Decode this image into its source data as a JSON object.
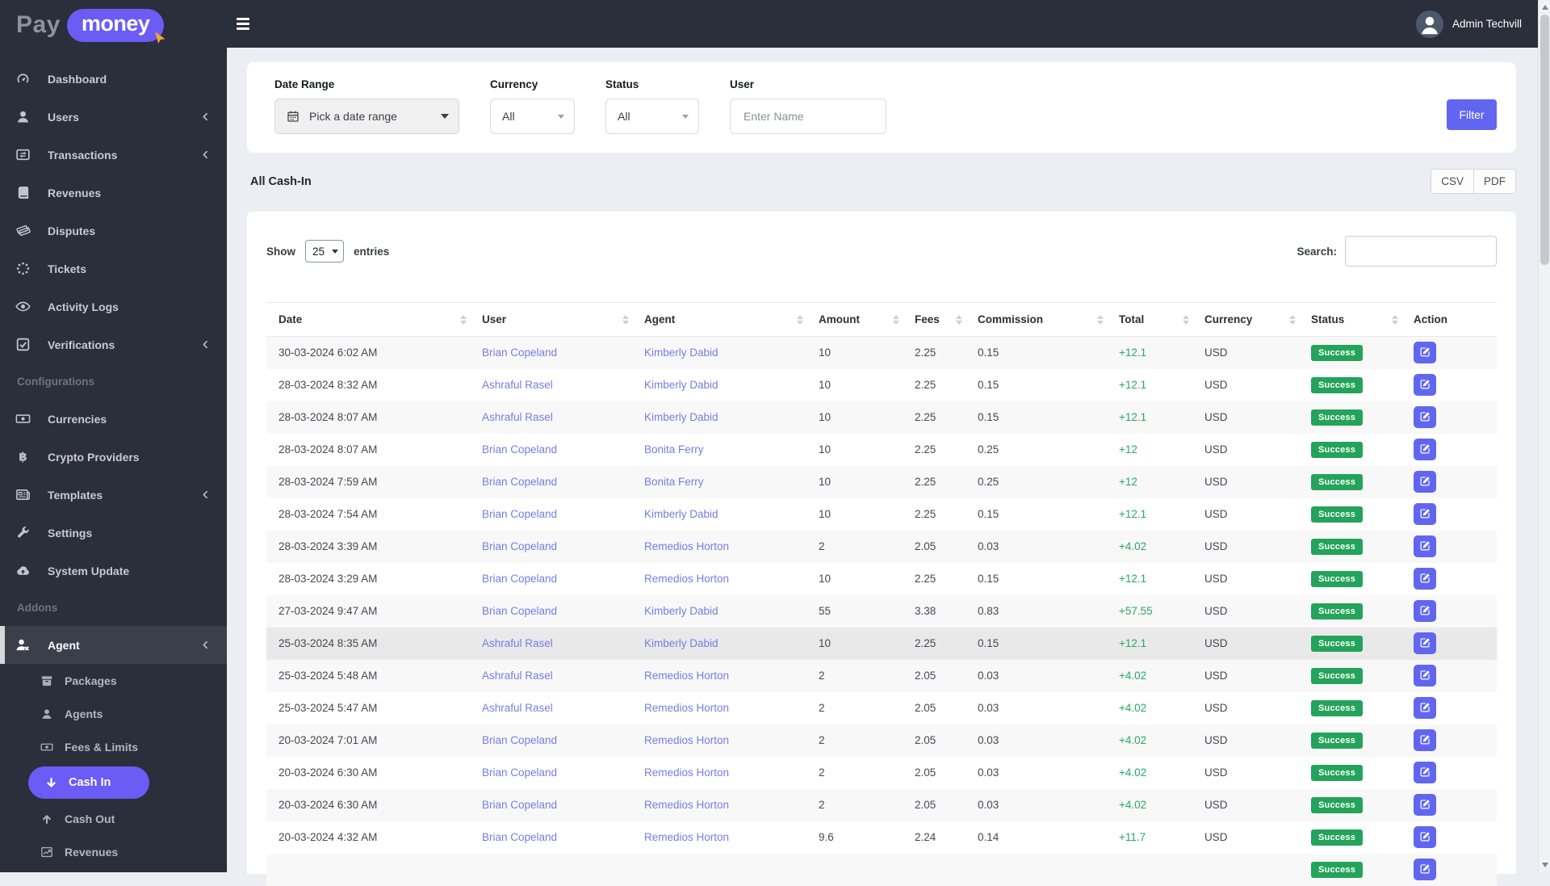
{
  "colors": {
    "sidebar_bg": "#2b2e3b",
    "brand_purple": "#6a5cf5",
    "primary": "#6166f0",
    "link": "#787ce2",
    "total_green": "#28a767",
    "badge_green": "#24a35a",
    "cursor_orange": "#f2a33c",
    "page_bg": "#edeef3"
  },
  "logo": {
    "part1": "Pay",
    "part2": "money"
  },
  "topbar": {
    "user_name": "Admin Techvill"
  },
  "sidebar": {
    "items": [
      {
        "type": "item",
        "icon": "gauge-icon",
        "label": "Dashboard"
      },
      {
        "type": "item",
        "icon": "user-icon",
        "label": "Users",
        "chevron": true
      },
      {
        "type": "item",
        "icon": "transactions-icon",
        "label": "Transactions",
        "chevron": true
      },
      {
        "type": "item",
        "icon": "book-icon",
        "label": "Revenues"
      },
      {
        "type": "item",
        "icon": "ticket-icon",
        "label": "Disputes"
      },
      {
        "type": "item",
        "icon": "spinner-icon",
        "label": "Tickets"
      },
      {
        "type": "item",
        "icon": "eye-icon",
        "label": "Activity Logs"
      },
      {
        "type": "item",
        "icon": "check-square-icon",
        "label": "Verifications",
        "chevron": true
      },
      {
        "type": "section",
        "label": "Configurations"
      },
      {
        "type": "item",
        "icon": "money-icon",
        "label": "Currencies"
      },
      {
        "type": "item",
        "icon": "bitcoin-icon",
        "label": "Crypto Providers"
      },
      {
        "type": "item",
        "icon": "newspaper-icon",
        "label": "Templates",
        "chevron": true
      },
      {
        "type": "item",
        "icon": "wrench-icon",
        "label": "Settings"
      },
      {
        "type": "item",
        "icon": "cloud-upload-icon",
        "label": "System Update"
      },
      {
        "type": "section",
        "label": "Addons"
      },
      {
        "type": "item",
        "icon": "user-x-icon",
        "label": "Agent",
        "chevron": true,
        "active": true
      },
      {
        "type": "subitem",
        "icon": "box-icon",
        "label": "Packages"
      },
      {
        "type": "subitem",
        "icon": "user-icon",
        "label": "Agents"
      },
      {
        "type": "subitem",
        "icon": "money-icon",
        "label": "Fees & Limits"
      },
      {
        "type": "pill",
        "icon": "arrow-down-icon",
        "label": "Cash In"
      },
      {
        "type": "subitem",
        "icon": "arrow-up-icon",
        "label": "Cash Out"
      },
      {
        "type": "subitem",
        "icon": "chart-icon",
        "label": "Revenues"
      }
    ]
  },
  "filters": {
    "date_range": {
      "label": "Date Range",
      "value": "Pick a date range"
    },
    "currency": {
      "label": "Currency",
      "value": "All"
    },
    "status": {
      "label": "Status",
      "value": "All"
    },
    "user": {
      "label": "User",
      "placeholder": "Enter Name"
    },
    "filter_button": "Filter"
  },
  "listing": {
    "title": "All Cash-In",
    "export_buttons": [
      "CSV",
      "PDF"
    ],
    "show_label": "Show",
    "page_length": "25",
    "entries_label": "entries",
    "search_label": "Search:"
  },
  "table": {
    "columns": [
      "Date",
      "User",
      "Agent",
      "Amount",
      "Fees",
      "Commission",
      "Total",
      "Currency",
      "Status",
      "Action"
    ],
    "rows": [
      {
        "date": "30-03-2024 6:02 AM",
        "user": "Brian Copeland",
        "agent": "Kimberly Dabid",
        "amount": "10",
        "fees": "2.25",
        "commission": "0.15",
        "total": "+12.1",
        "currency": "USD",
        "status": "Success"
      },
      {
        "date": "28-03-2024 8:32 AM",
        "user": "Ashraful Rasel",
        "agent": "Kimberly Dabid",
        "amount": "10",
        "fees": "2.25",
        "commission": "0.15",
        "total": "+12.1",
        "currency": "USD",
        "status": "Success"
      },
      {
        "date": "28-03-2024 8:07 AM",
        "user": "Ashraful Rasel",
        "agent": "Kimberly Dabid",
        "amount": "10",
        "fees": "2.25",
        "commission": "0.15",
        "total": "+12.1",
        "currency": "USD",
        "status": "Success"
      },
      {
        "date": "28-03-2024 8:07 AM",
        "user": "Brian Copeland",
        "agent": "Bonita Ferry",
        "amount": "10",
        "fees": "2.25",
        "commission": "0.25",
        "total": "+12",
        "currency": "USD",
        "status": "Success"
      },
      {
        "date": "28-03-2024 7:59 AM",
        "user": "Brian Copeland",
        "agent": "Bonita Ferry",
        "amount": "10",
        "fees": "2.25",
        "commission": "0.25",
        "total": "+12",
        "currency": "USD",
        "status": "Success"
      },
      {
        "date": "28-03-2024 7:54 AM",
        "user": "Brian Copeland",
        "agent": "Kimberly Dabid",
        "amount": "10",
        "fees": "2.25",
        "commission": "0.15",
        "total": "+12.1",
        "currency": "USD",
        "status": "Success"
      },
      {
        "date": "28-03-2024 3:39 AM",
        "user": "Brian Copeland",
        "agent": "Remedios Horton",
        "amount": "2",
        "fees": "2.05",
        "commission": "0.03",
        "total": "+4.02",
        "currency": "USD",
        "status": "Success"
      },
      {
        "date": "28-03-2024 3:29 AM",
        "user": "Brian Copeland",
        "agent": "Remedios Horton",
        "amount": "10",
        "fees": "2.25",
        "commission": "0.15",
        "total": "+12.1",
        "currency": "USD",
        "status": "Success"
      },
      {
        "date": "27-03-2024 9:47 AM",
        "user": "Brian Copeland",
        "agent": "Kimberly Dabid",
        "amount": "55",
        "fees": "3.38",
        "commission": "0.83",
        "total": "+57.55",
        "currency": "USD",
        "status": "Success"
      },
      {
        "date": "25-03-2024 8:35 AM",
        "user": "Ashraful Rasel",
        "agent": "Kimberly Dabid",
        "amount": "10",
        "fees": "2.25",
        "commission": "0.15",
        "total": "+12.1",
        "currency": "USD",
        "status": "Success",
        "highlighted": true
      },
      {
        "date": "25-03-2024 5:48 AM",
        "user": "Ashraful Rasel",
        "agent": "Remedios Horton",
        "amount": "2",
        "fees": "2.05",
        "commission": "0.03",
        "total": "+4.02",
        "currency": "USD",
        "status": "Success"
      },
      {
        "date": "25-03-2024 5:47 AM",
        "user": "Ashraful Rasel",
        "agent": "Remedios Horton",
        "amount": "2",
        "fees": "2.05",
        "commission": "0.03",
        "total": "+4.02",
        "currency": "USD",
        "status": "Success"
      },
      {
        "date": "20-03-2024 7:01 AM",
        "user": "Brian Copeland",
        "agent": "Remedios Horton",
        "amount": "2",
        "fees": "2.05",
        "commission": "0.03",
        "total": "+4.02",
        "currency": "USD",
        "status": "Success"
      },
      {
        "date": "20-03-2024 6:30 AM",
        "user": "Brian Copeland",
        "agent": "Remedios Horton",
        "amount": "2",
        "fees": "2.05",
        "commission": "0.03",
        "total": "+4.02",
        "currency": "USD",
        "status": "Success"
      },
      {
        "date": "20-03-2024 6:30 AM",
        "user": "Brian Copeland",
        "agent": "Remedios Horton",
        "amount": "2",
        "fees": "2.05",
        "commission": "0.03",
        "total": "+4.02",
        "currency": "USD",
        "status": "Success"
      },
      {
        "date": "20-03-2024 4:32 AM",
        "user": "Brian Copeland",
        "agent": "Remedios Horton",
        "amount": "9.6",
        "fees": "2.24",
        "commission": "0.14",
        "total": "+11.7",
        "currency": "USD",
        "status": "Success"
      }
    ],
    "partial_row": {
      "status": "Success"
    }
  }
}
